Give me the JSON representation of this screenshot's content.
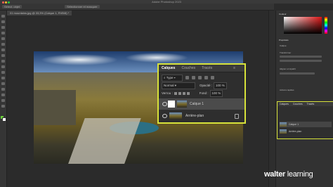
{
  "window": {
    "title": "Adobe Photoshop 2023"
  },
  "options_bar": {
    "items": [
      "Sélect. objet",
      "Sélectionner et masquer"
    ]
  },
  "document": {
    "tab_label": "01 mountains.jpg @ 33,3% (Calque 1, RVB/8) *"
  },
  "right_panel": {
    "color_tab": "Couleur",
    "props_tab": "Propriétés",
    "labels": [
      "Calque",
      "Transformer",
      "Aligner et répartir",
      "Actions rapides"
    ]
  },
  "layers_panel": {
    "tabs": [
      "Calques",
      "Couches",
      "Tracés"
    ],
    "active_tab": "Calques",
    "filter_value": "Type",
    "blend_mode": "Normal",
    "opacity_label": "Opacité :",
    "opacity_value": "100 %",
    "lock_label": "Verrou :",
    "fill_label": "Fond :",
    "fill_value": "100 %",
    "layers": [
      {
        "name": "Calque 1",
        "selected": true
      },
      {
        "name": "Arrière-plan",
        "selected": false,
        "locked": true
      }
    ]
  },
  "mini_layers_panel": {
    "tabs": [
      "Calques",
      "Couches",
      "Tracés"
    ],
    "layers": [
      "Calque 1",
      "Arrière-plan"
    ]
  },
  "branding": {
    "part1": "walter",
    "part2": " learning"
  },
  "colors": {
    "highlight": "#d7e23a",
    "background": "#2b2b2b",
    "panel": "#323232"
  }
}
